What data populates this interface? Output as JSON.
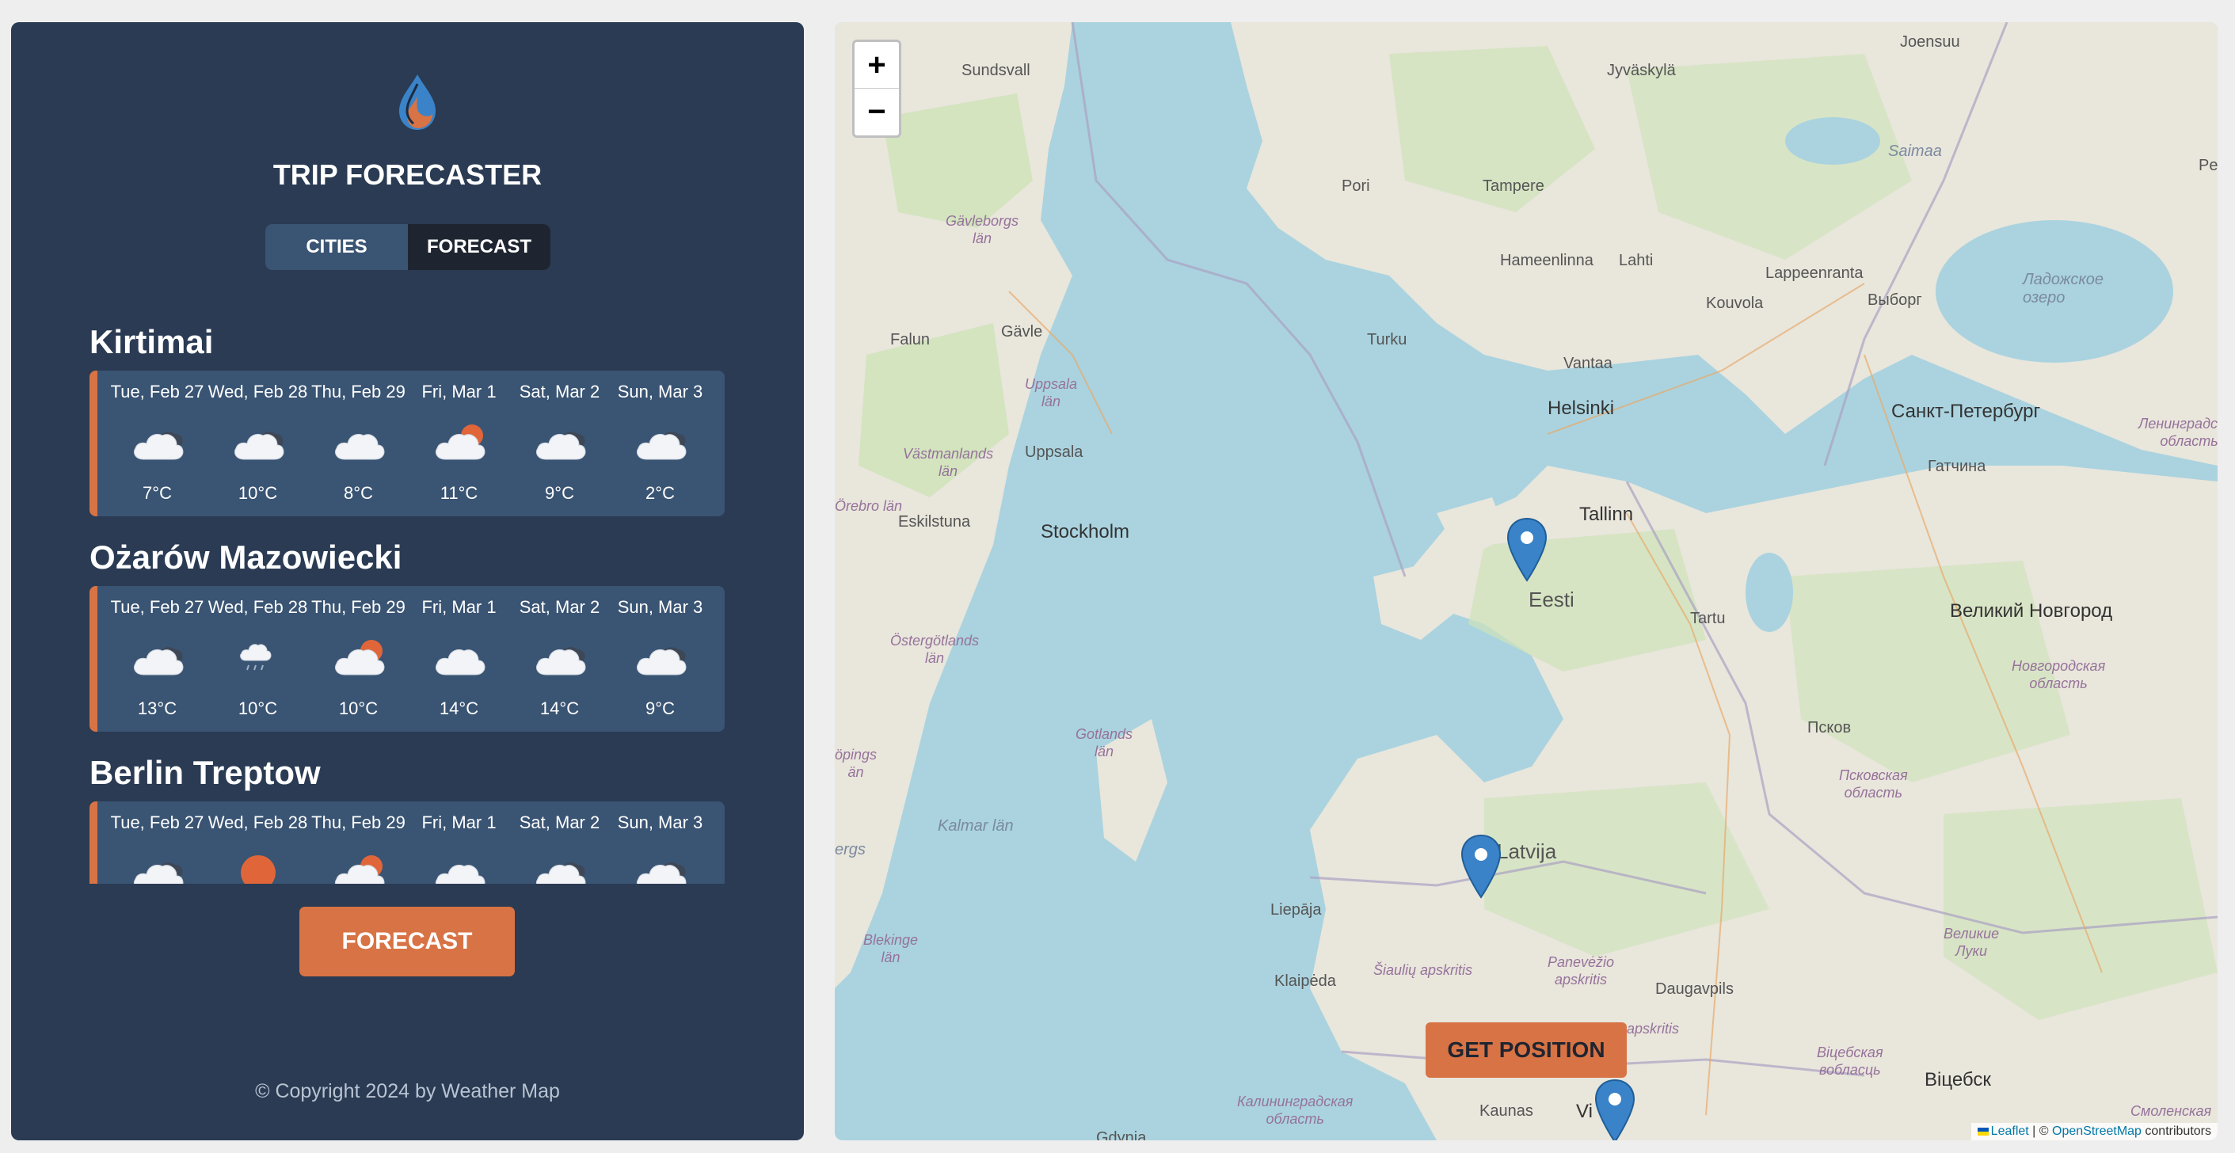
{
  "app": {
    "title": "TRIP FORECASTER",
    "copyright": "© Copyright 2024 by Weather Map"
  },
  "tabs": [
    {
      "label": "CITIES",
      "active": false
    },
    {
      "label": "FORECAST",
      "active": true
    }
  ],
  "cities": [
    {
      "name": "Kirtimai",
      "days": [
        {
          "date": "Tue, Feb 27",
          "icon": "cloud-dark",
          "temp": "7°C"
        },
        {
          "date": "Wed, Feb 28",
          "icon": "cloud-dark",
          "temp": "10°C"
        },
        {
          "date": "Thu, Feb 29",
          "icon": "cloud",
          "temp": "8°C"
        },
        {
          "date": "Fri, Mar 1",
          "icon": "cloud-sun",
          "temp": "11°C"
        },
        {
          "date": "Sat, Mar 2",
          "icon": "cloud-dark",
          "temp": "9°C"
        },
        {
          "date": "Sun, Mar 3",
          "icon": "cloud-dark",
          "temp": "2°C"
        }
      ]
    },
    {
      "name": "Ożarów Mazowiecki",
      "days": [
        {
          "date": "Tue, Feb 27",
          "icon": "cloud-dark",
          "temp": "13°C"
        },
        {
          "date": "Wed, Feb 28",
          "icon": "cloud-rain",
          "temp": "10°C"
        },
        {
          "date": "Thu, Feb 29",
          "icon": "cloud-sun",
          "temp": "10°C"
        },
        {
          "date": "Fri, Mar 1",
          "icon": "cloud",
          "temp": "14°C"
        },
        {
          "date": "Sat, Mar 2",
          "icon": "cloud-dark",
          "temp": "14°C"
        },
        {
          "date": "Sun, Mar 3",
          "icon": "cloud-dark",
          "temp": "9°C"
        }
      ]
    },
    {
      "name": "Berlin Treptow",
      "days": [
        {
          "date": "Tue, Feb 27",
          "icon": "cloud-dark",
          "temp": ""
        },
        {
          "date": "Wed, Feb 28",
          "icon": "sun",
          "temp": ""
        },
        {
          "date": "Thu, Feb 29",
          "icon": "cloud-sun",
          "temp": ""
        },
        {
          "date": "Fri, Mar 1",
          "icon": "cloud",
          "temp": ""
        },
        {
          "date": "Sat, Mar 2",
          "icon": "cloud-dark",
          "temp": ""
        },
        {
          "date": "Sun, Mar 3",
          "icon": "cloud-dark",
          "temp": ""
        }
      ]
    }
  ],
  "forecast_button": "FORECAST",
  "map": {
    "zoom_in": "+",
    "zoom_out": "−",
    "get_position": "GET POSITION",
    "attribution": {
      "leaflet": "Leaflet",
      "separator": " | © ",
      "osm": "OpenStreetMap",
      "suffix": " contributors"
    },
    "labels": {
      "sundsvall": "Sundsvall",
      "jyvaskyla": "Jyväskylä",
      "joensuu": "Joensuu",
      "pe": "Pe",
      "saimaa": "Saimaa",
      "pori": "Pori",
      "tampere": "Tampere",
      "gavleborgs": "Gävleborgs\nlän",
      "hameenlinna": "Hameenlinna",
      "lahti": "Lahti",
      "lappeenranta": "Lappeenranta",
      "vyborg": "Выборг",
      "kouvola": "Kouvola",
      "ladoga": "Ладожское\nозеро",
      "falun": "Falun",
      "gavle": "Gävle",
      "turku": "Turku",
      "vantaa": "Vantaa",
      "helsinki": "Helsinki",
      "spb": "Санкт-Петербург",
      "uppsala_lan": "Uppsala\nlän",
      "uppsala": "Uppsala",
      "leningrad_obl": "Ленинградская\nобласть",
      "vastmanlands": "Västmanlands\nlän",
      "gatchina": "Гатчина",
      "orebro": "Örebro län",
      "eskilstuna": "Eskilstuna",
      "stockholm": "Stockholm",
      "tallinn": "Tallinn",
      "eesti": "Eesti",
      "tartu": "Tartu",
      "veliky_novgorod": "Великий Новгород",
      "ostergotlands": "Östergötlands\nlän",
      "novgorod_obl": "Новгородская\nобласть",
      "pskov": "Псков",
      "pskov_obl": "Псковская\nобласть",
      "jonkopings": "öpings\nän",
      "gotlands": "Gotlands\nlän",
      "kalmar": "Kalmar län",
      "latvija": "Latvija",
      "ergs": "ergs",
      "liepaja": "Liepāja",
      "blekinge": "Blekinge\nlän",
      "velikie_luki": "Великие\nЛуки",
      "siauliu": "Šiaulių apskritis",
      "panevezio": "Panevėžio\napskritis",
      "klaipeda": "Klaipėda",
      "daugavpils": "Daugavpils",
      "apskritis": "apskritis",
      "vitebsk_obl": "Віцебская\nвобласць",
      "vitebsk": "Віцебск",
      "kaliningrad": "Калининградская\nобласть",
      "kaunas": "Kaunas",
      "vilnius": "Vi",
      "gdynia": "Gdynia",
      "smolensk": "Смоленская"
    }
  },
  "colors": {
    "sidebar": "#2a3b53",
    "card": "#3a5473",
    "accent": "#d87345",
    "tab_active": "#1f2530",
    "water": "#aad3df",
    "land": "#e9e6dc",
    "forest": "#cde3b8",
    "marker": "#3a83c8"
  }
}
